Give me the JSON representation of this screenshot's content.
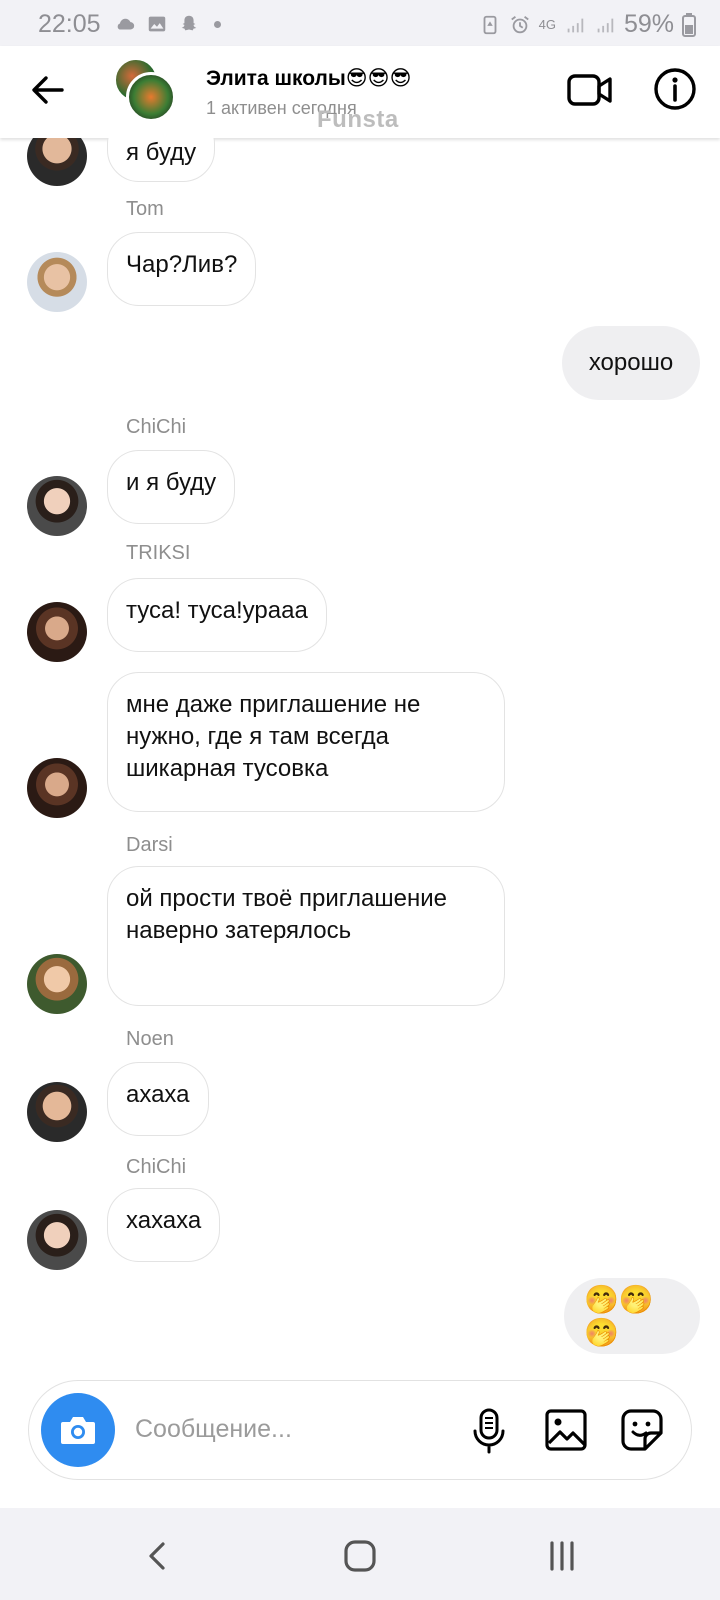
{
  "status_bar": {
    "time": "22:05",
    "signal": "4G",
    "battery": "59%"
  },
  "header": {
    "title": "Элита школы😎😎😎",
    "status": "1 активен сегодня",
    "watermark": "Funsta"
  },
  "messages": [
    {
      "sender": "",
      "text": "я буду",
      "direction": "in"
    },
    {
      "sender": "Tom",
      "text": "Чар?Лив?",
      "direction": "in"
    },
    {
      "sender": "",
      "text": "хорошо",
      "direction": "out"
    },
    {
      "sender": "ChiChi",
      "text": "и я буду",
      "direction": "in"
    },
    {
      "sender": "TRIKSI",
      "text": "туса! туса!урааа",
      "direction": "in"
    },
    {
      "sender": "",
      "text": "мне даже приглашение не нужно, где я там всегда шикарная тусовка",
      "direction": "in"
    },
    {
      "sender": "Darsi",
      "text": "ой прости твоё приглашение наверно затерялось",
      "direction": "in"
    },
    {
      "sender": "Noen",
      "text": "ахаха",
      "direction": "in"
    },
    {
      "sender": "ChiChi",
      "text": "хахаха",
      "direction": "in"
    },
    {
      "sender": "",
      "text": "🤭🤭🤭",
      "direction": "out"
    }
  ],
  "composer": {
    "placeholder": "Сообщение..."
  },
  "icons": {
    "back": "arrow-left-icon",
    "video": "video-camera-icon",
    "info": "info-icon",
    "camera": "camera-icon",
    "mic": "microphone-icon",
    "gallery": "image-icon",
    "sticker": "sticker-icon"
  },
  "colors": {
    "accent": "#2f8cf0",
    "outgoing_bubble": "#efeff1",
    "incoming_border": "#e3e3e3",
    "secondary_text": "#8e8e8e"
  }
}
